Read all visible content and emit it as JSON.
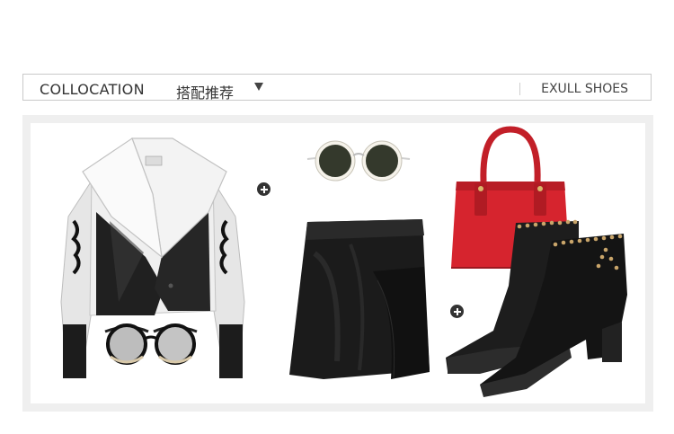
{
  "header": {
    "title_en": "COLLOCATION",
    "title_cn": "搭配推荐",
    "brand_link": "EXULL SHOES"
  },
  "icons": {
    "dropdown": "triangle-down-icon",
    "plus": "plus-icon"
  },
  "colors": {
    "header_border": "#c9c9c9",
    "panel_bg": "#efefef",
    "text": "#333333",
    "bag_red": "#d6242e"
  }
}
